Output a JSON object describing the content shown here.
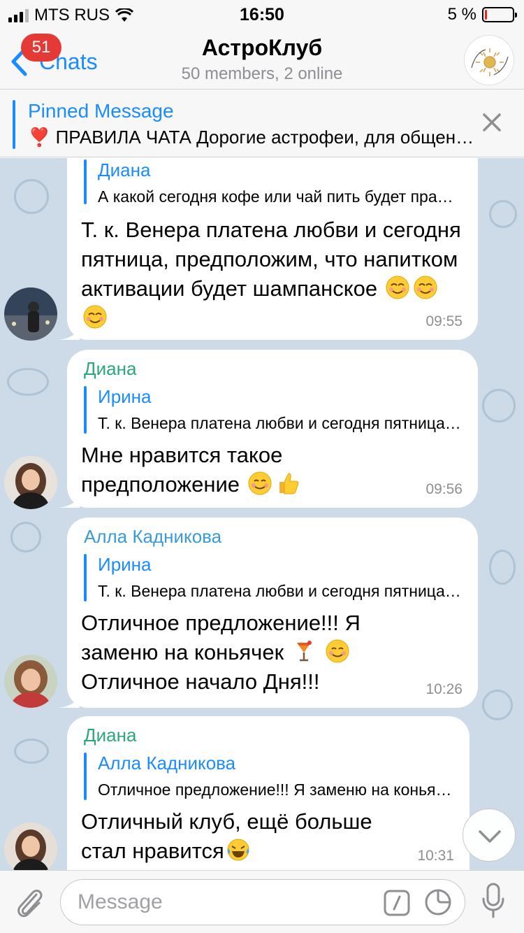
{
  "status_bar": {
    "carrier": "MTS RUS",
    "time": "16:50",
    "battery": "5 %",
    "battery_level": 0.05
  },
  "nav": {
    "back_label": "Chats",
    "unread_badge": "51",
    "title": "АстроКлуб",
    "subtitle": "50 members, 2 online"
  },
  "pinned": {
    "title": "Pinned Message",
    "text": "❣️ ПРАВИЛА ЧАТА  Дорогие астрофеи, для общения в этом чате"
  },
  "messages": [
    {
      "reply_name": "Диана",
      "reply_text": "А какой сегодня кофе или чай пить будет правильно?",
      "text": "Т. к. Венера платена любви и сегодня пятница, предположим, что напитком активации будет шампанское",
      "emojis": [
        "relieved-face",
        "relieved-face",
        "relieved-face"
      ],
      "time": "09:55"
    },
    {
      "sender": "Диана",
      "sender_color": "#2aa87a",
      "reply_name": "Ирина",
      "reply_text": "Т. к. Венера платена любви и сегодня пятница, предположим",
      "text": "Мне нравится такое предположение",
      "emojis": [
        "smiling-face",
        "thumbs-up"
      ],
      "time": "09:56"
    },
    {
      "sender": "Алла Кадникова",
      "sender_color": "#3a9ad9",
      "reply_name": "Ирина",
      "reply_text": "Т. к. Венера платена любви и сегодня пятница, предположим",
      "text_line1": "Отличное предложение!!! Я",
      "text_line2": "заменю на коньячек",
      "text_line3": "Отличное начало Дня!!!",
      "emojis": [
        "cocktail",
        "smiling-face"
      ],
      "time": "10:26"
    },
    {
      "sender": "Диана",
      "sender_color": "#2aa87a",
      "reply_name": "Алла Кадникова",
      "reply_text": "Отличное предложение!!! Я заменю на коньячек",
      "text": "Отличный клуб, ещё больше стал нравится",
      "emojis": [
        "tears-of-joy"
      ],
      "time": "10:31"
    }
  ],
  "input": {
    "placeholder": "Message"
  },
  "colors": {
    "accent": "#1a8cff",
    "chat_bg": "#cddbe8",
    "badge": "#e53935"
  },
  "icons": [
    "back-chevron-icon",
    "close-icon",
    "attach-icon",
    "command-icon",
    "sticker-icon",
    "microphone-icon",
    "chevron-down-icon"
  ]
}
